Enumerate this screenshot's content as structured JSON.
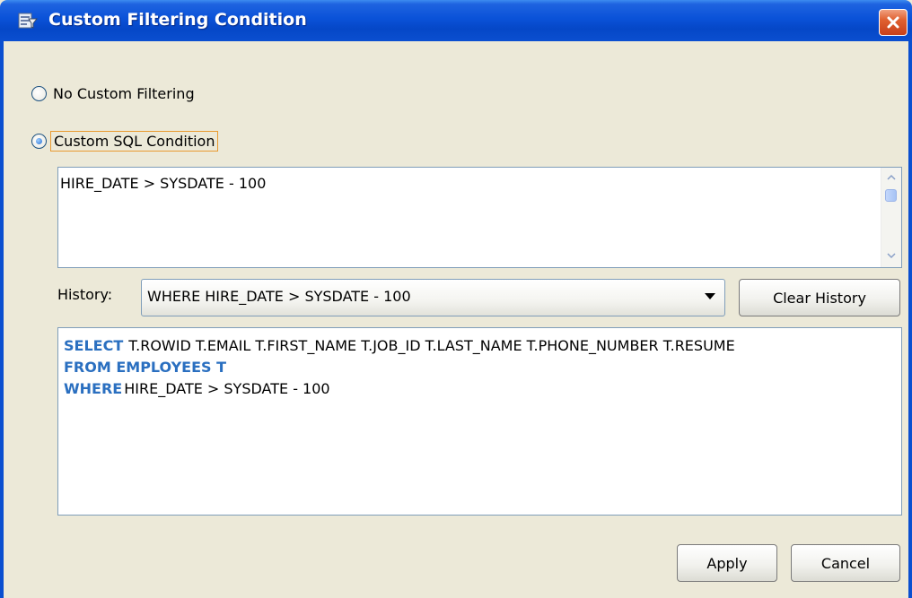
{
  "window": {
    "title": "Custom Filtering Condition",
    "app_icon": "filter-dialog-icon",
    "close_icon": "close-icon"
  },
  "options": {
    "no_custom": "No Custom Filtering",
    "custom_sql": "Custom SQL Condition",
    "selected": "custom_sql"
  },
  "condition": {
    "text": "HIRE_DATE > SYSDATE - 100"
  },
  "history": {
    "label": "History:",
    "selected": "WHERE HIRE_DATE > SYSDATE - 100",
    "clear_label": "Clear History"
  },
  "preview": {
    "select_kw": "SELECT",
    "select_cols": "T.ROWID T.EMAIL T.FIRST_NAME T.JOB_ID T.LAST_NAME T.PHONE_NUMBER T.RESUME",
    "from_kw": "FROM EMPLOYEES T",
    "where_kw": "WHERE",
    "where_text": "HIRE_DATE > SYSDATE - 100"
  },
  "buttons": {
    "apply": "Apply",
    "cancel": "Cancel"
  },
  "colors": {
    "titlebar": "#0a52d8",
    "sql_keyword": "#2a6fc0",
    "focus_border": "#e89a30",
    "close_button": "#e06030"
  }
}
